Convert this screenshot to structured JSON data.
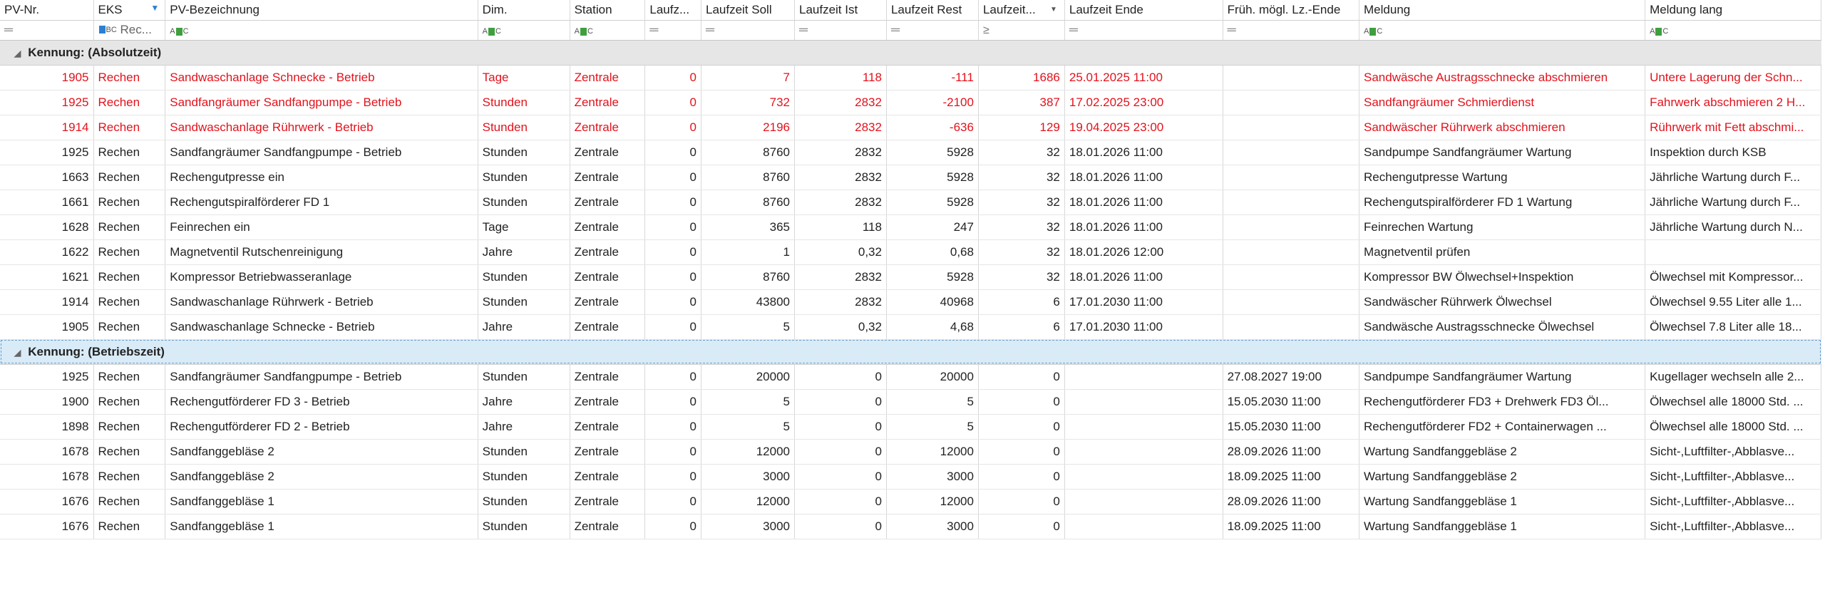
{
  "columns": [
    "PV-Nr.",
    "EKS",
    "PV-Bezeichnung",
    "Dim.",
    "Station",
    "Laufz...",
    "Laufzeit Soll",
    "Laufzeit Ist",
    "Laufzeit Rest",
    "Laufzeit...",
    "Laufzeit Ende",
    "Früh. mögl. Lz.-Ende",
    "Meldung",
    "Meldung lang"
  ],
  "filter_row": {
    "eks_text": "Rec..."
  },
  "groups": [
    {
      "label": "Kennung: (Absolutzeit)",
      "rows": [
        {
          "red": true,
          "cells": [
            "1905",
            "Rechen",
            "Sandwaschanlage Schnecke - Betrieb",
            "Tage",
            "Zentrale",
            "0",
            "7",
            "118",
            "-111",
            "1686",
            "25.01.2025 11:00",
            "",
            "Sandwäsche Austragsschnecke abschmieren",
            "Untere Lagerung der Schn..."
          ]
        },
        {
          "red": true,
          "cells": [
            "1925",
            "Rechen",
            "Sandfangräumer Sandfangpumpe - Betrieb",
            "Stunden",
            "Zentrale",
            "0",
            "732",
            "2832",
            "-2100",
            "387",
            "17.02.2025 23:00",
            "",
            "Sandfangräumer Schmierdienst",
            "Fahrwerk abschmieren 2 H..."
          ]
        },
        {
          "red": true,
          "cells": [
            "1914",
            "Rechen",
            "Sandwaschanlage Rührwerk - Betrieb",
            "Stunden",
            "Zentrale",
            "0",
            "2196",
            "2832",
            "-636",
            "129",
            "19.04.2025 23:00",
            "",
            "Sandwäscher Rührwerk abschmieren",
            "Rührwerk mit Fett abschmi..."
          ]
        },
        {
          "red": false,
          "cells": [
            "1925",
            "Rechen",
            "Sandfangräumer Sandfangpumpe - Betrieb",
            "Stunden",
            "Zentrale",
            "0",
            "8760",
            "2832",
            "5928",
            "32",
            "18.01.2026 11:00",
            "",
            "Sandpumpe Sandfangräumer Wartung",
            "Inspektion durch KSB"
          ]
        },
        {
          "red": false,
          "cells": [
            "1663",
            "Rechen",
            "Rechengutpresse ein",
            "Stunden",
            "Zentrale",
            "0",
            "8760",
            "2832",
            "5928",
            "32",
            "18.01.2026 11:00",
            "",
            "Rechengutpresse Wartung",
            "Jährliche Wartung durch F..."
          ]
        },
        {
          "red": false,
          "cells": [
            "1661",
            "Rechen",
            "Rechengutspiralförderer FD 1",
            "Stunden",
            "Zentrale",
            "0",
            "8760",
            "2832",
            "5928",
            "32",
            "18.01.2026 11:00",
            "",
            "Rechengutspiralförderer FD 1 Wartung",
            "Jährliche Wartung durch F..."
          ]
        },
        {
          "red": false,
          "cells": [
            "1628",
            "Rechen",
            "Feinrechen ein",
            "Tage",
            "Zentrale",
            "0",
            "365",
            "118",
            "247",
            "32",
            "18.01.2026 11:00",
            "",
            "Feinrechen Wartung",
            "Jährliche Wartung durch N..."
          ]
        },
        {
          "red": false,
          "cells": [
            "1622",
            "Rechen",
            "Magnetventil Rutschenreinigung",
            "Jahre",
            "Zentrale",
            "0",
            "1",
            "0,32",
            "0,68",
            "32",
            "18.01.2026 12:00",
            "",
            "Magnetventil prüfen",
            ""
          ]
        },
        {
          "red": false,
          "cells": [
            "1621",
            "Rechen",
            "Kompressor Betriebwasseranlage",
            "Stunden",
            "Zentrale",
            "0",
            "8760",
            "2832",
            "5928",
            "32",
            "18.01.2026 11:00",
            "",
            "Kompressor BW  Ölwechsel+Inspektion",
            "Ölwechsel mit Kompressor..."
          ]
        },
        {
          "red": false,
          "cells": [
            "1914",
            "Rechen",
            "Sandwaschanlage Rührwerk - Betrieb",
            "Stunden",
            "Zentrale",
            "0",
            "43800",
            "2832",
            "40968",
            "6",
            "17.01.2030 11:00",
            "",
            "Sandwäscher Rührwerk Ölwechsel",
            "Ölwechsel 9.55 Liter alle 1..."
          ]
        },
        {
          "red": false,
          "cells": [
            "1905",
            "Rechen",
            "Sandwaschanlage Schnecke - Betrieb",
            "Jahre",
            "Zentrale",
            "0",
            "5",
            "0,32",
            "4,68",
            "6",
            "17.01.2030 11:00",
            "",
            "Sandwäsche Austragsschnecke Ölwechsel",
            "Ölwechsel 7.8 Liter alle 18..."
          ]
        }
      ]
    },
    {
      "label": "Kennung: (Betriebszeit)",
      "rows": [
        {
          "red": false,
          "cells": [
            "1925",
            "Rechen",
            "Sandfangräumer Sandfangpumpe - Betrieb",
            "Stunden",
            "Zentrale",
            "0",
            "20000",
            "0",
            "20000",
            "0",
            "",
            "27.08.2027 19:00",
            "Sandpumpe Sandfangräumer Wartung",
            "Kugellager wechseln alle 2..."
          ]
        },
        {
          "red": false,
          "cells": [
            "1900",
            "Rechen",
            "Rechengutförderer FD 3 - Betrieb",
            "Jahre",
            "Zentrale",
            "0",
            "5",
            "0",
            "5",
            "0",
            "",
            "15.05.2030 11:00",
            "Rechengutförderer FD3 + Drehwerk FD3 Öl...",
            "Ölwechsel alle 18000 Std. ..."
          ]
        },
        {
          "red": false,
          "cells": [
            "1898",
            "Rechen",
            "Rechengutförderer FD 2 - Betrieb",
            "Jahre",
            "Zentrale",
            "0",
            "5",
            "0",
            "5",
            "0",
            "",
            "15.05.2030 11:00",
            "Rechengutförderer FD2 + Containerwagen ...",
            "Ölwechsel alle 18000 Std. ..."
          ]
        },
        {
          "red": false,
          "cells": [
            "1678",
            "Rechen",
            "Sandfanggebläse 2",
            "Stunden",
            "Zentrale",
            "0",
            "12000",
            "0",
            "12000",
            "0",
            "",
            "28.09.2026 11:00",
            "Wartung Sandfanggebläse 2",
            "Sicht-,Luftfilter-,Abblasve..."
          ]
        },
        {
          "red": false,
          "cells": [
            "1678",
            "Rechen",
            "Sandfanggebläse 2",
            "Stunden",
            "Zentrale",
            "0",
            "3000",
            "0",
            "3000",
            "0",
            "",
            "18.09.2025 11:00",
            "Wartung Sandfanggebläse 2",
            "Sicht-,Luftfilter-,Abblasve..."
          ]
        },
        {
          "red": false,
          "cells": [
            "1676",
            "Rechen",
            "Sandfanggebläse 1",
            "Stunden",
            "Zentrale",
            "0",
            "12000",
            "0",
            "12000",
            "0",
            "",
            "28.09.2026 11:00",
            "Wartung Sandfanggebläse 1",
            "Sicht-,Luftfilter-,Abblasve..."
          ]
        },
        {
          "red": false,
          "cells": [
            "1676",
            "Rechen",
            "Sandfanggebläse 1",
            "Stunden",
            "Zentrale",
            "0",
            "3000",
            "0",
            "3000",
            "0",
            "",
            "18.09.2025 11:00",
            "Wartung Sandfanggebläse 1",
            "Sicht-,Luftfilter-,Abblasve..."
          ]
        }
      ]
    }
  ],
  "colors": {
    "overdue_text": "#e3121c",
    "group_bg": "#e6e6e6",
    "group_focused_bg": "#d9ebf7",
    "filter_icon": "#2a7fd4"
  },
  "icons": {
    "filter_active": "funnel-icon",
    "sort_desc": "sort-descending-icon",
    "group_expand": "collapse-triangle-icon",
    "filter_equals": "equals-icon",
    "filter_text": "abc-filter-icon",
    "filter_greater_equal": "greater-equal-icon"
  }
}
